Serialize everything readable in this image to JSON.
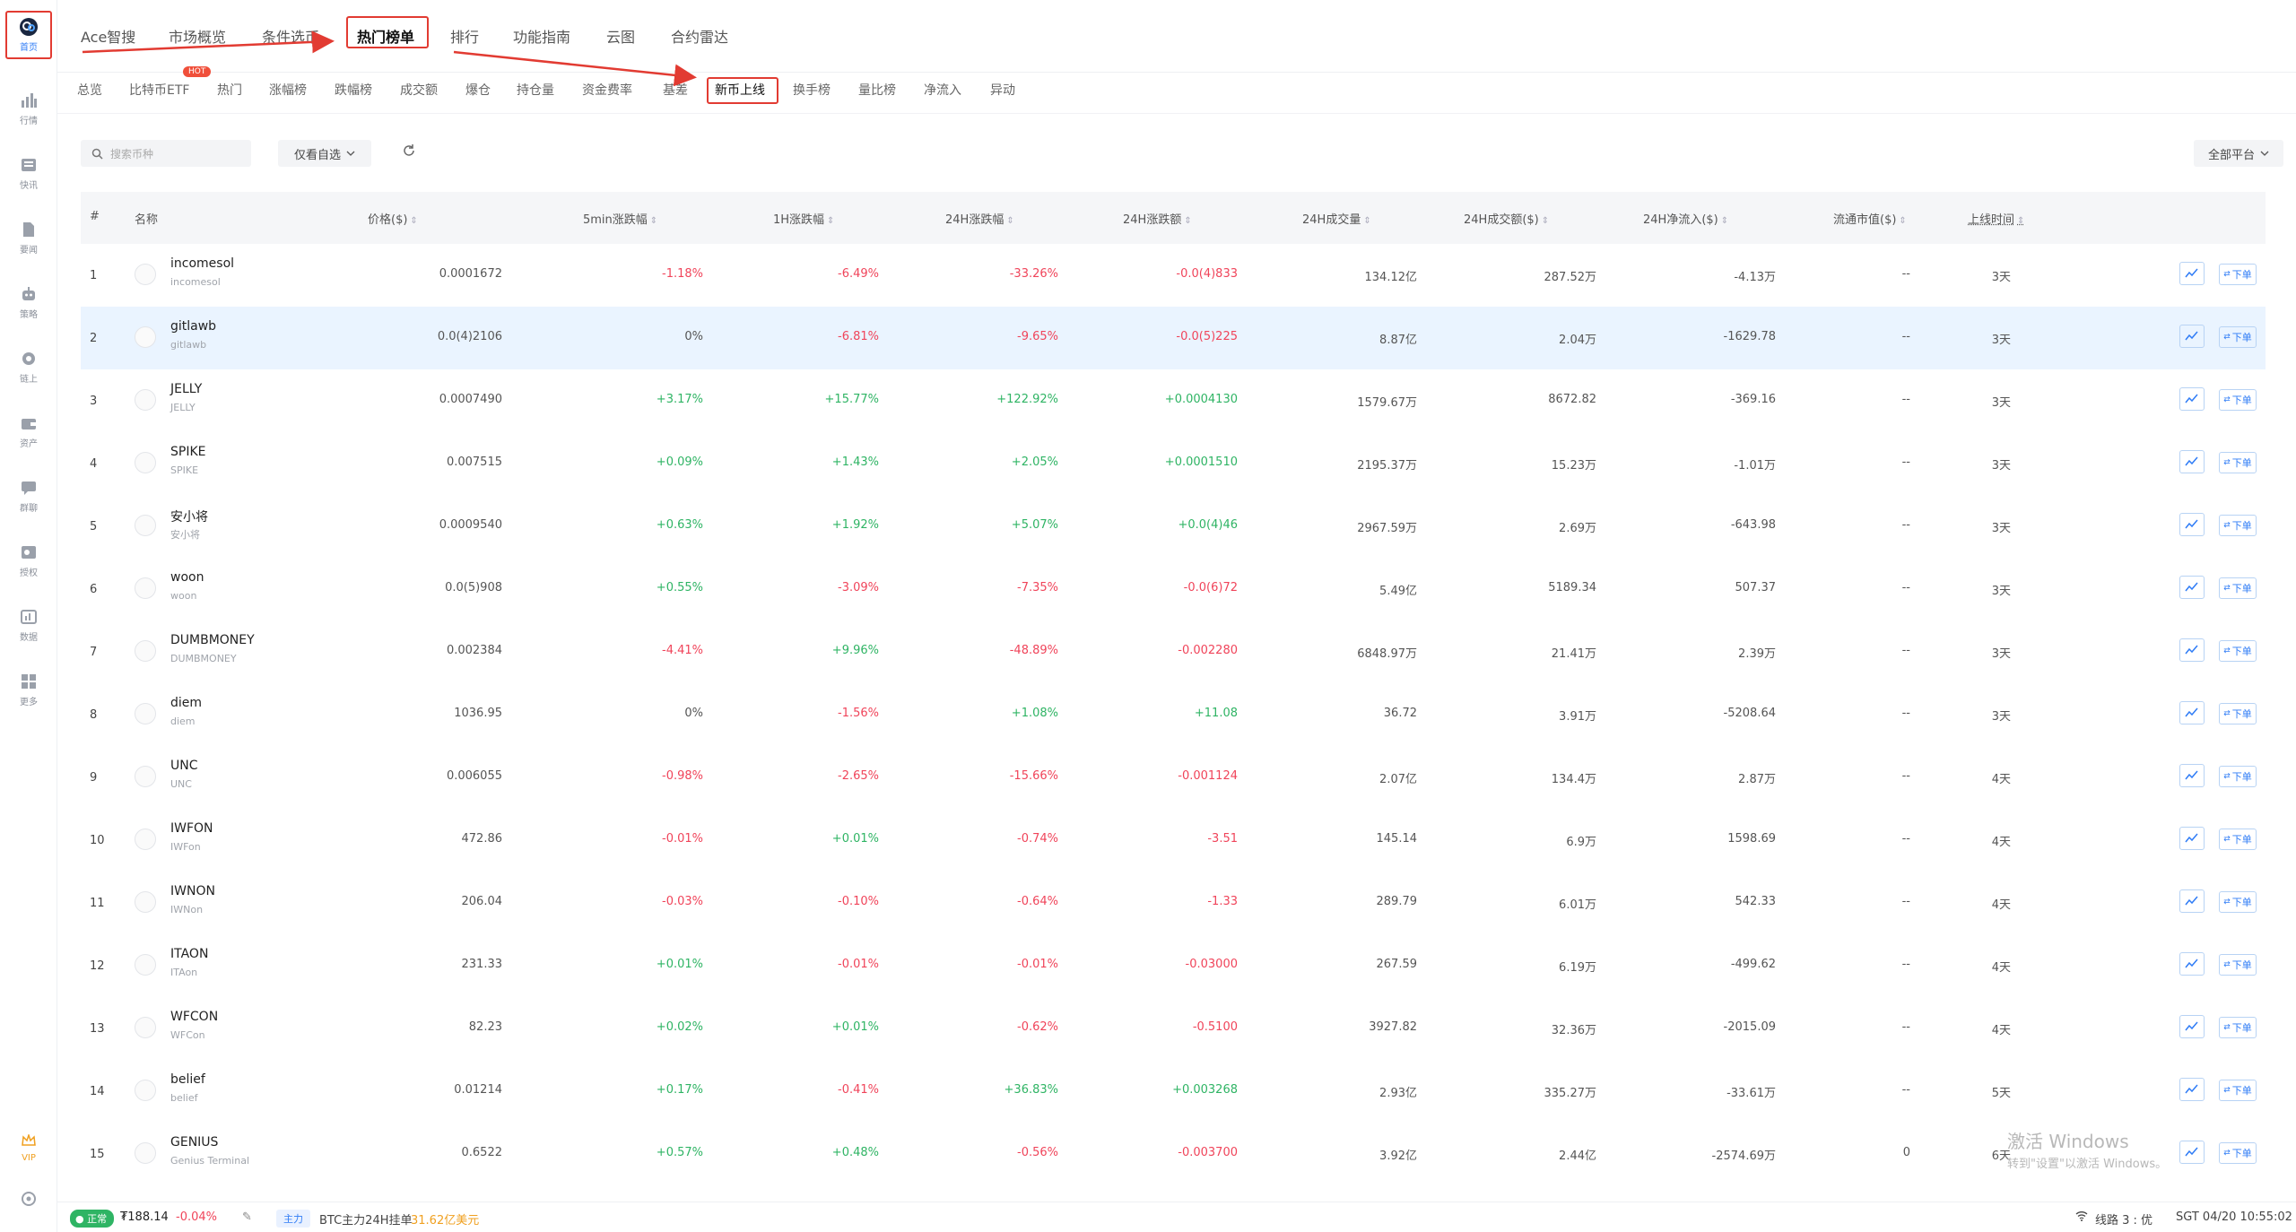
{
  "sidebar": {
    "items": [
      {
        "label": "首页",
        "icon": "home-logo-icon"
      },
      {
        "label": "行情",
        "icon": "bar-chart-icon"
      },
      {
        "label": "快讯",
        "icon": "news-icon"
      },
      {
        "label": "要闻",
        "icon": "document-icon"
      },
      {
        "label": "策略",
        "icon": "robot-icon"
      },
      {
        "label": "链上",
        "icon": "chain-icon"
      },
      {
        "label": "资产",
        "icon": "wallet-icon"
      },
      {
        "label": "群聊",
        "icon": "chat-icon"
      },
      {
        "label": "授权",
        "icon": "key-icon"
      },
      {
        "label": "数据",
        "icon": "data-icon"
      },
      {
        "label": "更多",
        "icon": "grid-icon"
      }
    ],
    "vip_label": "VIP",
    "settings_icon": "settings-icon"
  },
  "topnav": {
    "tabs": [
      "Ace智搜",
      "市场概览",
      "条件选币",
      "热门榜单",
      "排行",
      "功能指南",
      "云图",
      "合约雷达"
    ]
  },
  "subnav": {
    "tabs": [
      "总览",
      "比特币ETF",
      "热门",
      "涨幅榜",
      "跌幅榜",
      "成交额",
      "爆仓",
      "持仓量",
      "资金费率",
      "基差",
      "新币上线",
      "换手榜",
      "量比榜",
      "净流入",
      "异动"
    ],
    "hot_badge": "HOT"
  },
  "toolbar": {
    "search_placeholder": "搜索币种",
    "filter_label": "仅看自选",
    "platform_label": "全部平台"
  },
  "table": {
    "columns": [
      "#",
      "名称",
      "价格($)",
      "5min涨跌幅",
      "1H涨跌幅",
      "24H涨跌幅",
      "24H涨跌额",
      "24H成交量",
      "24H成交额($)",
      "24H净流入($)",
      "流通市值($)",
      "上线时间"
    ],
    "order_label": "下单",
    "rows": [
      {
        "rank": "1",
        "name": "incomesol",
        "symbol": "incomesol",
        "price": "0.0001672",
        "c5m": "-1.18%",
        "c1h": "-6.49%",
        "c24h": "-33.26%",
        "amt24h": "-0.0(4)833",
        "vol": "134.12亿",
        "turnover": "287.52万",
        "inflow": "-4.13万",
        "mcap": "--",
        "listed": "3天",
        "dir": [
          "down",
          "down",
          "down",
          "down"
        ]
      },
      {
        "rank": "2",
        "name": "gitlawb",
        "symbol": "gitlawb",
        "price": "0.0(4)2106",
        "c5m": "0%",
        "c1h": "-6.81%",
        "c24h": "-9.65%",
        "amt24h": "-0.0(5)225",
        "vol": "8.87亿",
        "turnover": "2.04万",
        "inflow": "-1629.78",
        "mcap": "--",
        "listed": "3天",
        "dir": [
          "flat",
          "down",
          "down",
          "down"
        ]
      },
      {
        "rank": "3",
        "name": "JELLY",
        "symbol": "JELLY",
        "price": "0.0007490",
        "c5m": "+3.17%",
        "c1h": "+15.77%",
        "c24h": "+122.92%",
        "amt24h": "+0.0004130",
        "vol": "1579.67万",
        "turnover": "8672.82",
        "inflow": "-369.16",
        "mcap": "--",
        "listed": "3天",
        "dir": [
          "up",
          "up",
          "up",
          "up"
        ]
      },
      {
        "rank": "4",
        "name": "SPIKE",
        "symbol": "SPIKE",
        "price": "0.007515",
        "c5m": "+0.09%",
        "c1h": "+1.43%",
        "c24h": "+2.05%",
        "amt24h": "+0.0001510",
        "vol": "2195.37万",
        "turnover": "15.23万",
        "inflow": "-1.01万",
        "mcap": "--",
        "listed": "3天",
        "dir": [
          "up",
          "up",
          "up",
          "up"
        ]
      },
      {
        "rank": "5",
        "name": "安小将",
        "symbol": "安小将",
        "price": "0.0009540",
        "c5m": "+0.63%",
        "c1h": "+1.92%",
        "c24h": "+5.07%",
        "amt24h": "+0.0(4)46",
        "vol": "2967.59万",
        "turnover": "2.69万",
        "inflow": "-643.98",
        "mcap": "--",
        "listed": "3天",
        "dir": [
          "up",
          "up",
          "up",
          "up"
        ]
      },
      {
        "rank": "6",
        "name": "woon",
        "symbol": "woon",
        "price": "0.0(5)908",
        "c5m": "+0.55%",
        "c1h": "-3.09%",
        "c24h": "-7.35%",
        "amt24h": "-0.0(6)72",
        "vol": "5.49亿",
        "turnover": "5189.34",
        "inflow": "507.37",
        "mcap": "--",
        "listed": "3天",
        "dir": [
          "up",
          "down",
          "down",
          "down"
        ]
      },
      {
        "rank": "7",
        "name": "DUMBMONEY",
        "symbol": "DUMBMONEY",
        "price": "0.002384",
        "c5m": "-4.41%",
        "c1h": "+9.96%",
        "c24h": "-48.89%",
        "amt24h": "-0.002280",
        "vol": "6848.97万",
        "turnover": "21.41万",
        "inflow": "2.39万",
        "mcap": "--",
        "listed": "3天",
        "dir": [
          "down",
          "up",
          "down",
          "down"
        ]
      },
      {
        "rank": "8",
        "name": "diem",
        "symbol": "diem",
        "price": "1036.95",
        "c5m": "0%",
        "c1h": "-1.56%",
        "c24h": "+1.08%",
        "amt24h": "+11.08",
        "vol": "36.72",
        "turnover": "3.91万",
        "inflow": "-5208.64",
        "mcap": "--",
        "listed": "3天",
        "dir": [
          "flat",
          "down",
          "up",
          "up"
        ]
      },
      {
        "rank": "9",
        "name": "UNC",
        "symbol": "UNC",
        "price": "0.006055",
        "c5m": "-0.98%",
        "c1h": "-2.65%",
        "c24h": "-15.66%",
        "amt24h": "-0.001124",
        "vol": "2.07亿",
        "turnover": "134.4万",
        "inflow": "2.87万",
        "mcap": "--",
        "listed": "4天",
        "dir": [
          "down",
          "down",
          "down",
          "down"
        ]
      },
      {
        "rank": "10",
        "name": "IWFON",
        "symbol": "IWFon",
        "price": "472.86",
        "c5m": "-0.01%",
        "c1h": "+0.01%",
        "c24h": "-0.74%",
        "amt24h": "-3.51",
        "vol": "145.14",
        "turnover": "6.9万",
        "inflow": "1598.69",
        "mcap": "--",
        "listed": "4天",
        "dir": [
          "down",
          "up",
          "down",
          "down"
        ]
      },
      {
        "rank": "11",
        "name": "IWNON",
        "symbol": "IWNon",
        "price": "206.04",
        "c5m": "-0.03%",
        "c1h": "-0.10%",
        "c24h": "-0.64%",
        "amt24h": "-1.33",
        "vol": "289.79",
        "turnover": "6.01万",
        "inflow": "542.33",
        "mcap": "--",
        "listed": "4天",
        "dir": [
          "down",
          "down",
          "down",
          "down"
        ]
      },
      {
        "rank": "12",
        "name": "ITAON",
        "symbol": "ITAon",
        "price": "231.33",
        "c5m": "+0.01%",
        "c1h": "-0.01%",
        "c24h": "-0.01%",
        "amt24h": "-0.03000",
        "vol": "267.59",
        "turnover": "6.19万",
        "inflow": "-499.62",
        "mcap": "--",
        "listed": "4天",
        "dir": [
          "up",
          "down",
          "down",
          "down"
        ]
      },
      {
        "rank": "13",
        "name": "WFCON",
        "symbol": "WFCon",
        "price": "82.23",
        "c5m": "+0.02%",
        "c1h": "+0.01%",
        "c24h": "-0.62%",
        "amt24h": "-0.5100",
        "vol": "3927.82",
        "turnover": "32.36万",
        "inflow": "-2015.09",
        "mcap": "--",
        "listed": "4天",
        "dir": [
          "up",
          "up",
          "down",
          "down"
        ]
      },
      {
        "rank": "14",
        "name": "belief",
        "symbol": "belief",
        "price": "0.01214",
        "c5m": "+0.17%",
        "c1h": "-0.41%",
        "c24h": "+36.83%",
        "amt24h": "+0.003268",
        "vol": "2.93亿",
        "turnover": "335.27万",
        "inflow": "-33.61万",
        "mcap": "--",
        "listed": "5天",
        "dir": [
          "up",
          "down",
          "up",
          "up"
        ]
      },
      {
        "rank": "15",
        "name": "GENIUS",
        "symbol": "Genius Terminal",
        "price": "0.6522",
        "c5m": "+0.57%",
        "c1h": "+0.48%",
        "c24h": "-0.56%",
        "amt24h": "-0.003700",
        "vol": "3.92亿",
        "turnover": "2.44亿",
        "inflow": "-2574.69万",
        "mcap": "0",
        "listed": "6天",
        "dir": [
          "up",
          "up",
          "down",
          "down"
        ]
      }
    ]
  },
  "statusbar": {
    "status": "正常",
    "price": "₮188.14",
    "change": "-0.04%",
    "main_tag": "主力",
    "btc_text": "BTC主力24H挂单",
    "btc_value": "31.62亿美元",
    "line": "线路 3 : 优",
    "time": "SGT 04/20 10:55:02"
  },
  "watermark": {
    "line1": "激活 Windows",
    "line2": "转到\"设置\"以激活 Windows。"
  },
  "colors": {
    "up": "#2fb464",
    "down": "#f0445a",
    "accent": "#2f7cf6",
    "highlight": "#e23b32"
  }
}
